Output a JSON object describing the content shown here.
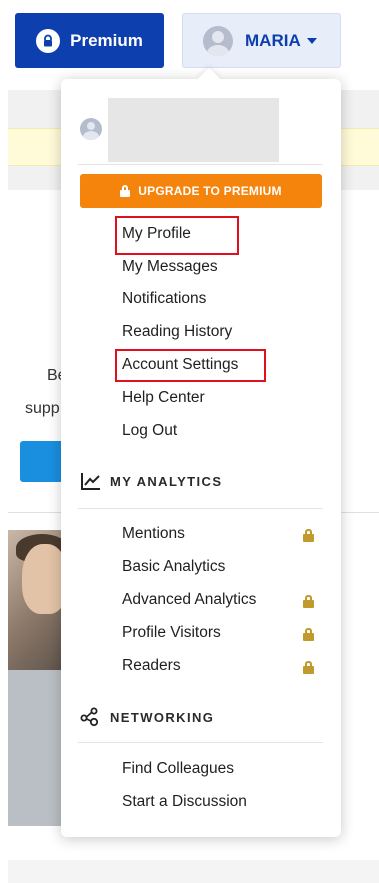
{
  "header": {
    "premium_label": "Premium",
    "user_label": "MARIA"
  },
  "background": {
    "text_line1": "Be",
    "text_line2": "supp"
  },
  "menu": {
    "upgrade_label": "UPGRADE TO PREMIUM",
    "account_items": [
      {
        "label": "My Profile"
      },
      {
        "label": "My Messages"
      },
      {
        "label": "Notifications"
      },
      {
        "label": "Reading History"
      },
      {
        "label": "Account Settings"
      },
      {
        "label": "Help Center"
      },
      {
        "label": "Log Out"
      }
    ],
    "analytics": {
      "title": "MY ANALYTICS",
      "items": [
        {
          "label": "Mentions",
          "locked": true
        },
        {
          "label": "Basic Analytics",
          "locked": false
        },
        {
          "label": "Advanced Analytics",
          "locked": true
        },
        {
          "label": "Profile Visitors",
          "locked": true
        },
        {
          "label": "Readers",
          "locked": true
        }
      ]
    },
    "networking": {
      "title": "NETWORKING",
      "items": [
        {
          "label": "Find Colleagues"
        },
        {
          "label": "Start a Discussion"
        }
      ]
    }
  },
  "colors": {
    "premium_blue": "#0e3fae",
    "upgrade_orange": "#f5840c",
    "highlight_red": "#e0101e",
    "lock_gold": "#c19a2e"
  },
  "icons": {
    "premium": "lock-icon",
    "analytics": "analytics-chart-icon",
    "networking": "network-nodes-icon"
  }
}
